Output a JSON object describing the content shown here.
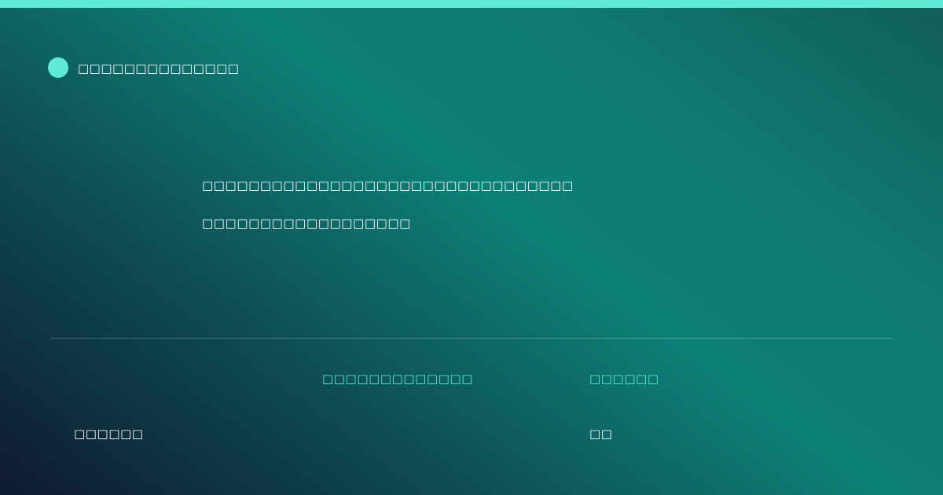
{
  "accent_color": "#5eead4",
  "brand": {
    "icon": "brand-dot-icon",
    "name": "□□□□□□□□□□□□□□"
  },
  "headline": {
    "line1": "□□□□□□□□□□□□□□□□□□□□□□□□□□□□□□□□",
    "line2": "□□□□□□□□□□□□□□□□□□"
  },
  "meta": {
    "left_label": "□□□□□□□□□□□□□",
    "left_value": "□□□□□□",
    "right_label": "□□□□□□",
    "right_value": "□□"
  }
}
